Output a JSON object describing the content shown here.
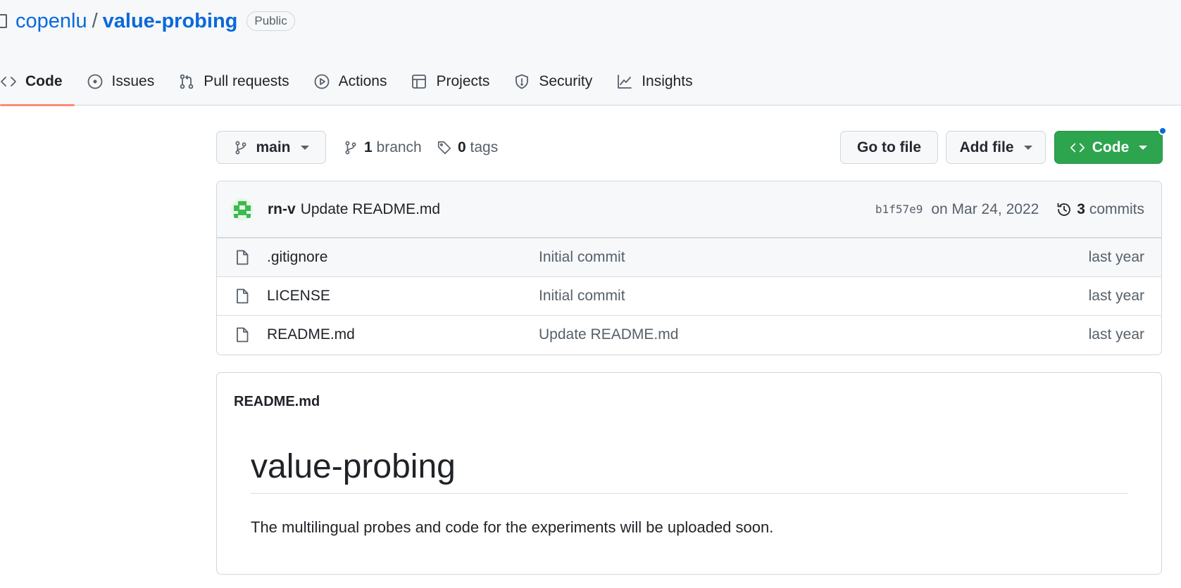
{
  "repo": {
    "owner": "copenlu",
    "separator": "/",
    "name": "value-probing",
    "visibility": "Public"
  },
  "tabs": [
    {
      "label": "Code",
      "icon": "code-icon",
      "selected": true
    },
    {
      "label": "Issues",
      "icon": "issue-icon"
    },
    {
      "label": "Pull requests",
      "icon": "pull-request-icon"
    },
    {
      "label": "Actions",
      "icon": "play-icon"
    },
    {
      "label": "Projects",
      "icon": "table-icon"
    },
    {
      "label": "Security",
      "icon": "shield-icon"
    },
    {
      "label": "Insights",
      "icon": "graph-icon"
    }
  ],
  "toolbar": {
    "branch": "main",
    "branch_count": "1",
    "branch_label": "branch",
    "tag_count": "0",
    "tag_label": "tags",
    "goto_file": "Go to file",
    "add_file": "Add file",
    "code": "Code"
  },
  "latest_commit": {
    "author": "rn-v",
    "message": "Update README.md",
    "sha": "b1f57e9",
    "date": "on Mar 24, 2022",
    "commit_count": "3",
    "commits_label": "commits"
  },
  "files": [
    {
      "name": ".gitignore",
      "commit": "Initial commit",
      "age": "last year"
    },
    {
      "name": "LICENSE",
      "commit": "Initial commit",
      "age": "last year"
    },
    {
      "name": "README.md",
      "commit": "Update README.md",
      "age": "last year"
    }
  ],
  "readme": {
    "filename": "README.md",
    "heading": "value-probing",
    "body": "The multilingual probes and code for the experiments will be uploaded soon."
  },
  "colors": {
    "accent_link": "#0969da",
    "primary_button": "#2da44e",
    "tab_underline": "#fd8c73"
  }
}
